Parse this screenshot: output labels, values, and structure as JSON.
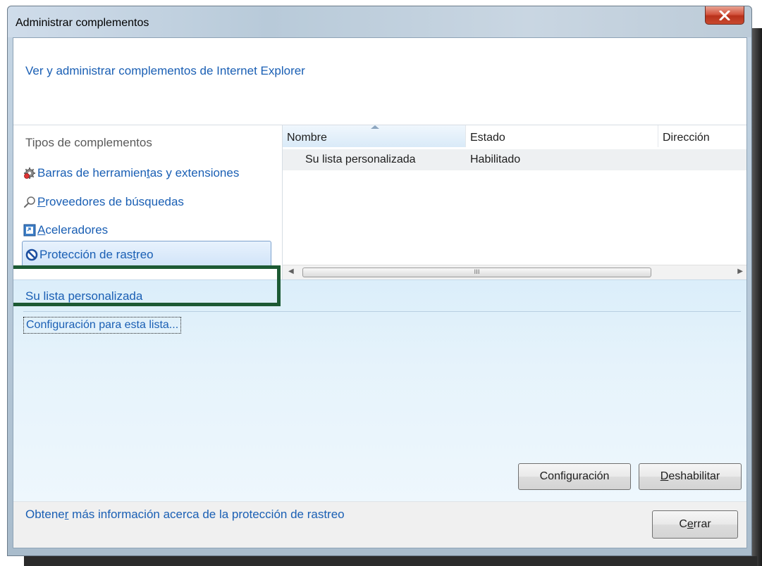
{
  "window": {
    "title": "Administrar complementos",
    "close_icon": "close-x-icon"
  },
  "header": {
    "link_text": "Ver y administrar complementos de Internet Explorer"
  },
  "sidebar": {
    "title": "Tipos de complementos",
    "items": [
      {
        "pre": "Barras de herramien",
        "mn": "t",
        "post": "as y extensiones",
        "icon": "gear-icon"
      },
      {
        "pre": "",
        "mn": "P",
        "post": "roveedores de búsquedas",
        "icon": "search-icon"
      },
      {
        "pre": "",
        "mn": "A",
        "post": "celeradores",
        "icon": "accelerator-icon"
      },
      {
        "pre": "Protección de ras",
        "mn": "t",
        "post": "reo",
        "icon": "no-entry-icon",
        "selected": true
      }
    ]
  },
  "list": {
    "columns": [
      "Nombre",
      "Estado",
      "Dirección"
    ],
    "rows": [
      {
        "name": "Su lista personalizada",
        "status": "Habilitado",
        "address": ""
      }
    ],
    "scroll_mark": "III"
  },
  "details": {
    "title": "Su lista personalizada",
    "settings_link": {
      "pre": "Confi",
      "mn": "g",
      "post": "uración para esta lista..."
    },
    "configure_button": {
      "pre": "Confi",
      "mn": "g",
      "post": "uración"
    },
    "disable_button": {
      "pre": "",
      "mn": "D",
      "post": "eshabilitar"
    }
  },
  "footer": {
    "learn_more": {
      "pre": "Obtene",
      "mn": "r",
      "post": " más información acerca de la protección de rastreo"
    },
    "close_button": {
      "pre": "C",
      "mn": "e",
      "post": "rrar"
    }
  },
  "colors": {
    "link": "#1a5fb4",
    "highlight_frame": "#1d5a34",
    "selection_border": "#7da2ce"
  }
}
